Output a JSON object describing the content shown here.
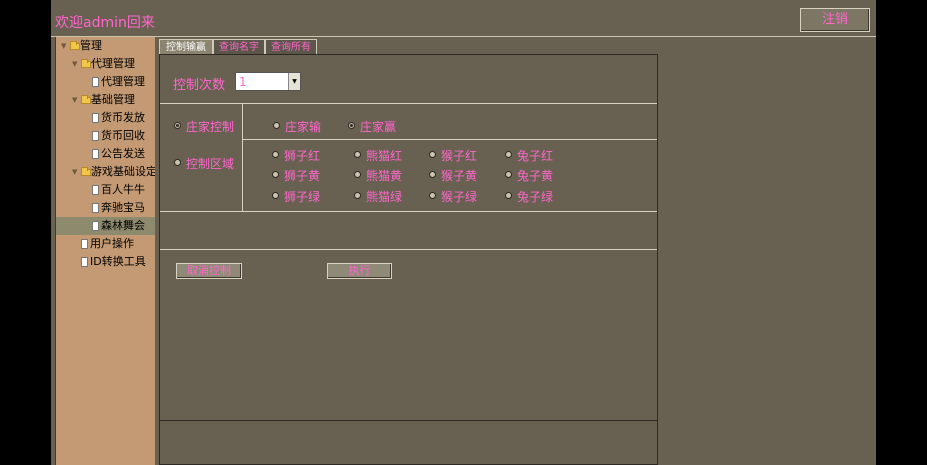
{
  "header": {
    "welcome": "欢迎admin回来",
    "logout_label": "注销"
  },
  "sidebar": {
    "items": [
      {
        "label": "管理",
        "kind": "folder"
      },
      {
        "label": "代理管理",
        "kind": "folder"
      },
      {
        "label": "代理管理",
        "kind": "file"
      },
      {
        "label": "基础管理",
        "kind": "folder"
      },
      {
        "label": "货币发放",
        "kind": "file"
      },
      {
        "label": "货币回收",
        "kind": "file"
      },
      {
        "label": "公告发送",
        "kind": "file"
      },
      {
        "label": "游戏基础设定",
        "kind": "folder"
      },
      {
        "label": "百人牛牛",
        "kind": "file"
      },
      {
        "label": "奔驰宝马",
        "kind": "file"
      },
      {
        "label": "森林舞会",
        "kind": "file",
        "selected": true
      },
      {
        "label": "用户操作",
        "kind": "file"
      },
      {
        "label": "ID转换工具",
        "kind": "file"
      }
    ]
  },
  "tabs": [
    {
      "label": "控制输赢",
      "active": true
    },
    {
      "label": "查询名字",
      "active": false
    },
    {
      "label": "查询所有",
      "active": false
    }
  ],
  "control": {
    "count_label": "控制次数",
    "count_value": "1",
    "banker_label": "庄家控制",
    "banker_lose": "庄家输",
    "banker_win": "庄家赢",
    "selected_banker_option": "庄家赢",
    "mode_selected": "庄家控制",
    "region_label": "控制区域",
    "regions": [
      [
        "狮子红",
        "熊猫红",
        "猴子红",
        "兔子红"
      ],
      [
        "狮子黄",
        "熊猫黄",
        "猴子黄",
        "兔子黄"
      ],
      [
        "狮子绿",
        "熊猫绿",
        "猴子绿",
        "兔子绿"
      ]
    ],
    "cancel_label": "取消控制",
    "execute_label": "执行"
  },
  "colors": {
    "accent_text": "#ff66cc",
    "background": "#686152",
    "sidebar": "#c39a73"
  }
}
